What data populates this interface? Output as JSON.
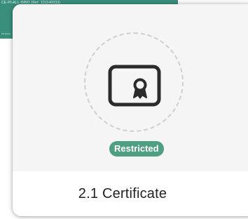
{
  "background": {
    "banner_text": "CE-PI-ALL-INNO (Ref. 101140033)",
    "banner_footnote": "the Europ..."
  },
  "card": {
    "icon": "certificate-icon",
    "badge_label": "Restricted",
    "title": "2.1 Certificate"
  },
  "colors": {
    "banner": "#3a8f7c",
    "badge": "#4f9f82",
    "media_background": "#f5f5f5",
    "icon_stroke": "#2b2b2b"
  }
}
